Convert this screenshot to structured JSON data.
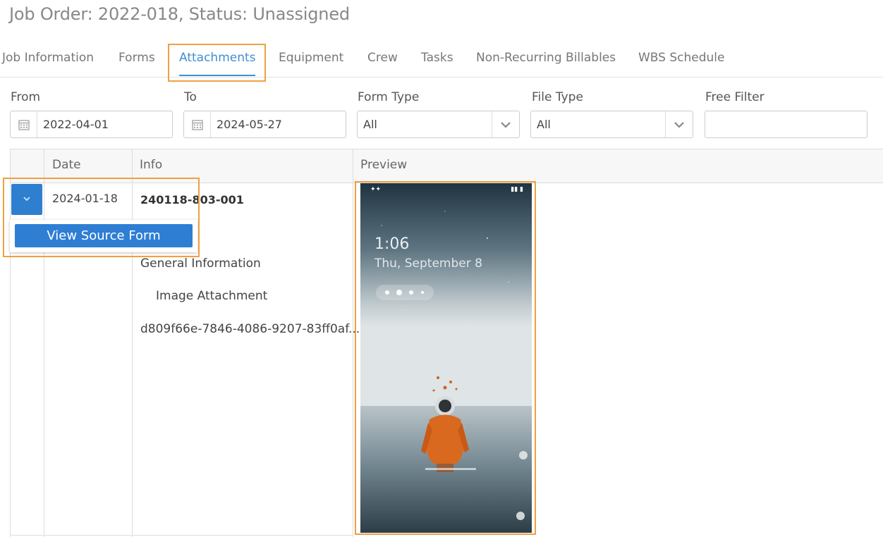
{
  "page": {
    "title": "Job Order: 2022-018, Status: Unassigned"
  },
  "tabs": [
    {
      "label": "Job Information"
    },
    {
      "label": "Forms"
    },
    {
      "label": "Attachments"
    },
    {
      "label": "Equipment"
    },
    {
      "label": "Crew"
    },
    {
      "label": "Tasks"
    },
    {
      "label": "Non-Recurring Billables"
    },
    {
      "label": "WBS Schedule"
    }
  ],
  "filters": {
    "from": {
      "label": "From",
      "value": "2022-04-01"
    },
    "to": {
      "label": "To",
      "value": "2024-05-27"
    },
    "form_type": {
      "label": "Form Type",
      "value": "All"
    },
    "file_type": {
      "label": "File Type",
      "value": "All"
    },
    "free_filter": {
      "label": "Free Filter",
      "value": ""
    }
  },
  "grid": {
    "columns": [
      "Date",
      "Info",
      "Preview"
    ],
    "rows": [
      {
        "date": "2024-01-18",
        "info_id": "240118-803-001",
        "info_section": "General Information",
        "info_item": "Image Attachment",
        "info_guid": "d809f66e-7846-4086-9207-83ff0af..."
      }
    ]
  },
  "row_menu": {
    "view_source_form": "View Source Form"
  },
  "preview_image": {
    "time": "1:06",
    "date": "Thu, September 8"
  },
  "colors": {
    "accent": "#3f8fd4",
    "button": "#2e7ed4",
    "highlight": "#f0a040"
  }
}
